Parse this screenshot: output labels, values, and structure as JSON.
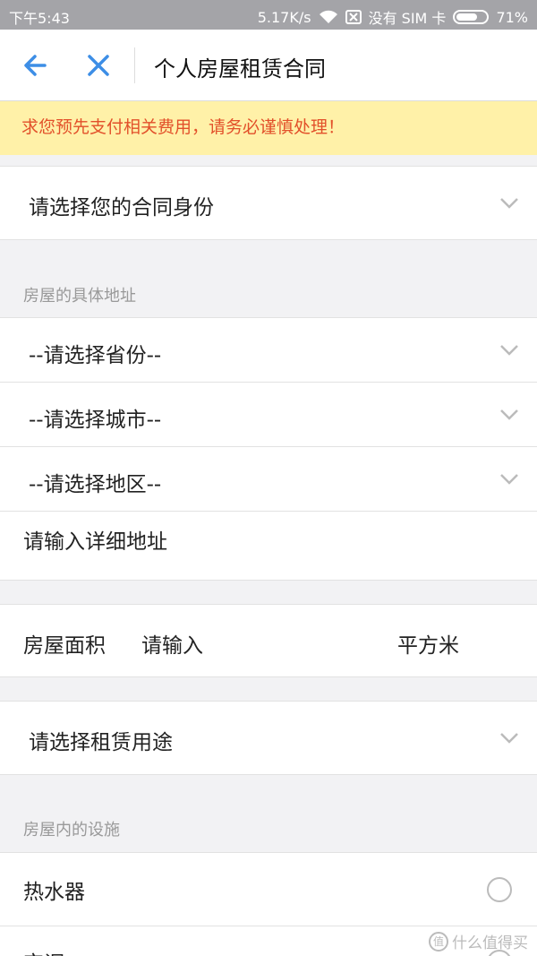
{
  "status_bar": {
    "time": "下午5:43",
    "speed": "5.17K/s",
    "sim_status": "没有 SIM 卡",
    "battery": "71%",
    "battery_level": 0.71
  },
  "header": {
    "title": "个人房屋租赁合同"
  },
  "notice": {
    "text": "求您预先支付相关费用，请务必谨慎处理！"
  },
  "form": {
    "identity_select": "请选择您的合同身份",
    "address_section_title": "房屋的具体地址",
    "province_select": "--请选择省份--",
    "city_select": "--请选择城市--",
    "district_select": "--请选择地区--",
    "detail_address_placeholder": "请输入详细地址",
    "area_label": "房屋面积",
    "area_placeholder": "请输入",
    "area_unit": "平方米",
    "usage_select": "请选择租赁用途",
    "facilities_section_title": "房屋内的设施",
    "facility_1": "热水器",
    "facility_2": "空调"
  },
  "watermark": {
    "text": "什么值得买"
  },
  "colors": {
    "accent_blue": "#3d8ee6",
    "notice_bg": "#fff1a8",
    "notice_text": "#e2502a"
  }
}
